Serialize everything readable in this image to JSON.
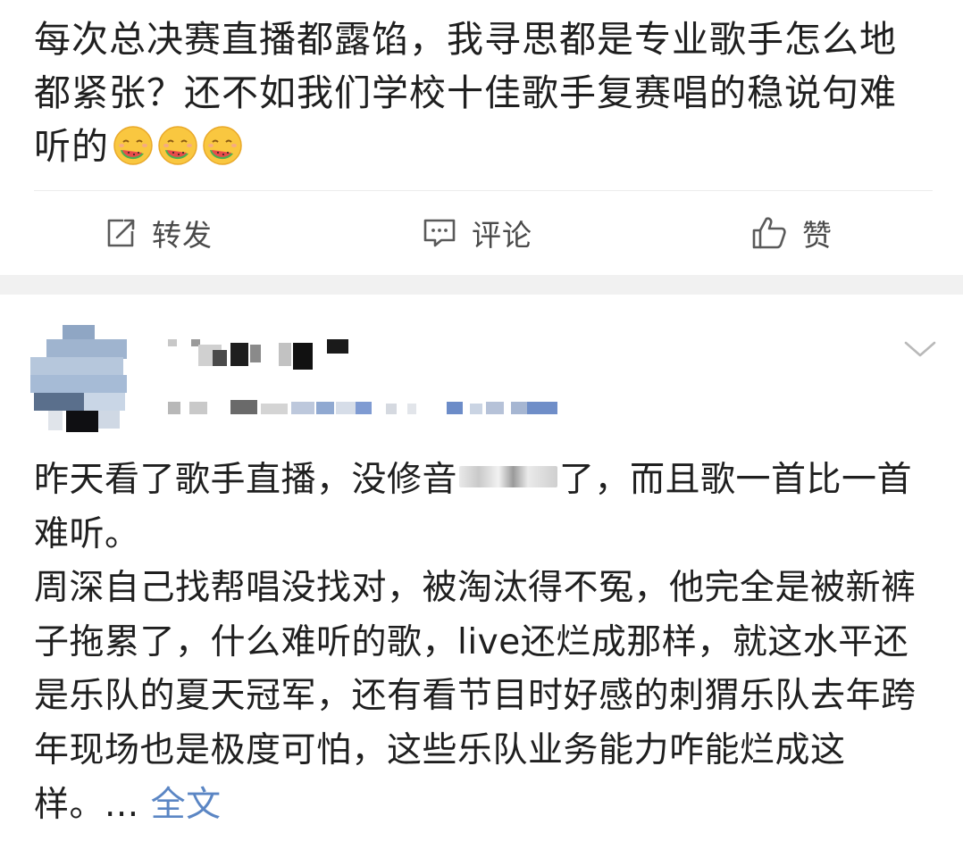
{
  "post1": {
    "text": "每次总决赛直播都露馅，我寻思都是专业歌手怎么地都紧张？还不如我们学校十佳歌手复赛唱的稳说句难听的",
    "emoji_name": "watermelon-face-emoji",
    "emoji_count": 3
  },
  "actions": {
    "repost": "转发",
    "comment": "评论",
    "like": "赞"
  },
  "post2": {
    "line1_before": "昨天看了歌手直播，没修音",
    "line1_after": "了，而且歌一首比一首难听。",
    "paragraph2": "周深自己找帮唱没找对，被淘汰得不冤，他完全是被新裤子拖累了，什么难听的歌，live还烂成那样，就这水平还是乐队的夏天冠军，还有看节目时好感的刺猬乐队去年跨年现场也是极度可怕，这些乐队业务能力咋能烂成这样。...",
    "full_text_link": "全文"
  },
  "colors": {
    "link": "#5b86c4",
    "text": "#1f1f1f",
    "band": "#f1f1f1"
  }
}
